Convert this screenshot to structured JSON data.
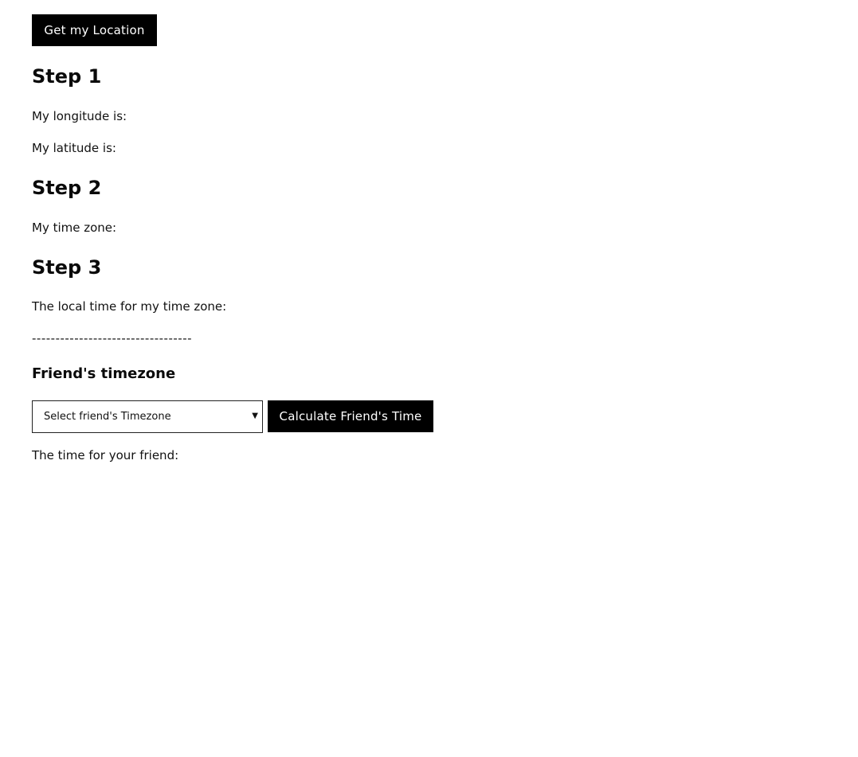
{
  "get_location_button": "Get my Location",
  "step1": {
    "heading": "Step 1",
    "longitude_label": "My longitude is:",
    "longitude_value": "",
    "latitude_label": "My latitude is:",
    "latitude_value": ""
  },
  "step2": {
    "heading": "Step 2",
    "timezone_label": "My time zone:",
    "timezone_value": ""
  },
  "step3": {
    "heading": "Step 3",
    "local_time_label": "The local time for my time zone:",
    "local_time_value": ""
  },
  "divider": "----------------------------------",
  "friend": {
    "heading": "Friend's timezone",
    "select_value": "Select friend's Timezone",
    "calculate_button": "Calculate Friend's Time",
    "friend_time_label": "The time for your friend:",
    "friend_time_value": ""
  }
}
